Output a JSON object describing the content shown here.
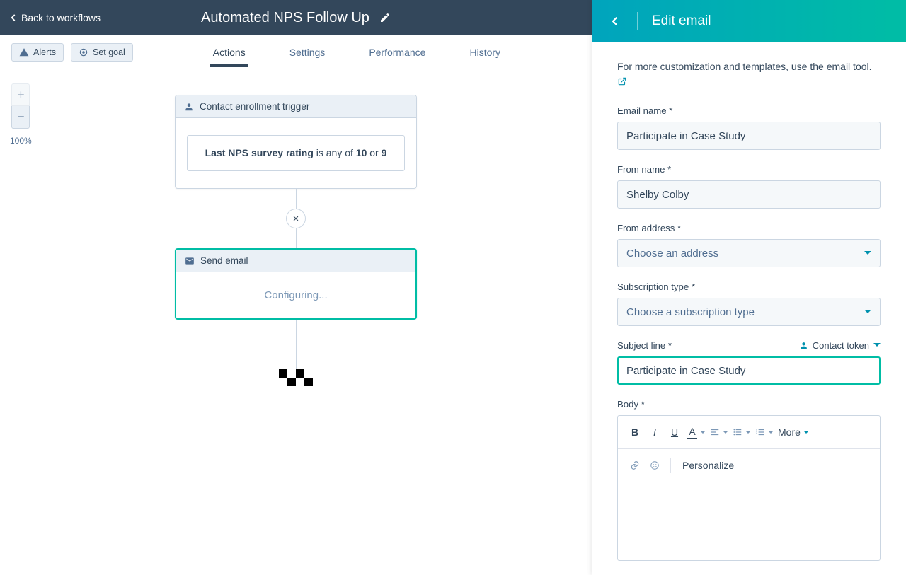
{
  "header": {
    "back_label": "Back to workflows",
    "workflow_title": "Automated NPS Follow Up"
  },
  "toolbar": {
    "alerts_label": "Alerts",
    "set_goal_label": "Set goal",
    "tabs": {
      "actions": "Actions",
      "settings": "Settings",
      "performance": "Performance",
      "history": "History"
    }
  },
  "canvas": {
    "zoom_level": "100%",
    "trigger": {
      "title": "Contact enrollment trigger",
      "line_prefix": "Last NPS survey rating",
      "line_mid": " is any of ",
      "val1": "10",
      "line_or": " or ",
      "val2": "9"
    },
    "add_node_symbol": "×",
    "action": {
      "title": "Send email",
      "status": "Configuring..."
    }
  },
  "panel": {
    "title": "Edit email",
    "helper_prefix": "For more customization and templates, use the ",
    "helper_link": "email tool.",
    "fields": {
      "email_name": {
        "label": "Email name *",
        "value": "Participate in Case Study"
      },
      "from_name": {
        "label": "From name *",
        "value": "Shelby Colby"
      },
      "from_address": {
        "label": "From address *",
        "placeholder": "Choose an address"
      },
      "subscription": {
        "label": "Subscription type *",
        "placeholder": "Choose a subscription type"
      },
      "subject": {
        "label": "Subject line *",
        "token_link": "Contact token",
        "value": "Participate in Case Study"
      },
      "body": {
        "label": "Body *",
        "more": "More",
        "personalize": "Personalize"
      }
    }
  }
}
